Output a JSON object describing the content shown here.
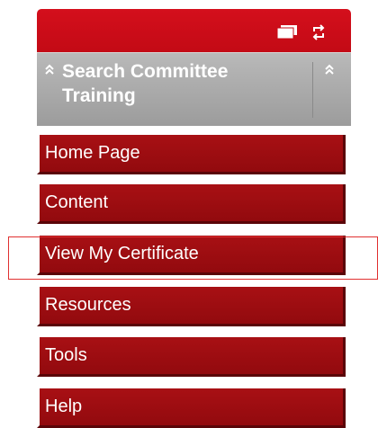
{
  "header": {
    "title": "Search Committee Training"
  },
  "icons": {
    "window": "window-icon",
    "refresh": "refresh-icon",
    "collapse": "double-chevron-up-icon"
  },
  "nav": {
    "items": [
      {
        "label": "Home Page"
      },
      {
        "label": "Content"
      },
      {
        "label": "View My Certificate",
        "highlighted": true
      },
      {
        "label": "Resources"
      },
      {
        "label": "Tools"
      },
      {
        "label": "Help"
      }
    ]
  },
  "colors": {
    "topbar": "#d40f1c",
    "header": "#a9a9a9",
    "nav_item": "#9e0d12",
    "highlight_outline": "#e03030"
  }
}
